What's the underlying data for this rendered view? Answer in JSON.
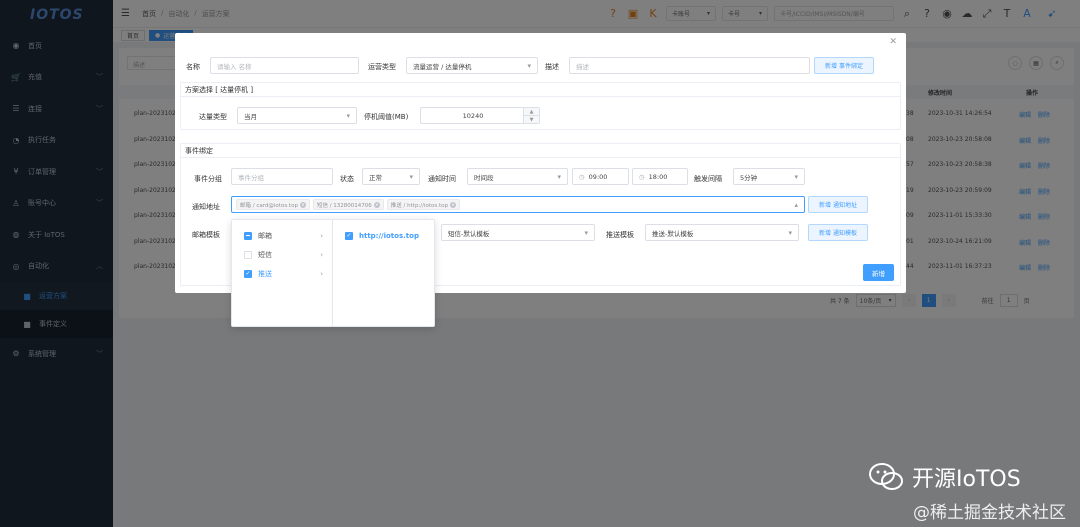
{
  "app": {
    "logo_text": "IOTOS"
  },
  "sidebar": {
    "items": [
      {
        "label": "首页",
        "icon": "dashboard-icon",
        "glyph": "◉"
      },
      {
        "label": "充值",
        "icon": "cart-icon",
        "glyph": "🛒",
        "has_children": true
      },
      {
        "label": "连接",
        "icon": "link-icon",
        "glyph": "☰",
        "has_children": true
      },
      {
        "label": "执行任务",
        "icon": "task-icon",
        "glyph": "◔"
      },
      {
        "label": "订单管理",
        "icon": "order-icon",
        "glyph": "¥",
        "has_children": true
      },
      {
        "label": "账号中心",
        "icon": "user-icon",
        "glyph": "♙",
        "has_children": true
      },
      {
        "label": "关于 IoTOS",
        "icon": "globe-icon",
        "glyph": "◍"
      },
      {
        "label": "自动化",
        "icon": "automation-icon",
        "glyph": "◎",
        "has_children": true,
        "open": true
      }
    ],
    "sub_items": [
      {
        "label": "运营方案",
        "active": true
      },
      {
        "label": "事件定义",
        "active": false
      }
    ],
    "last_item": {
      "label": "系统管理",
      "icon": "settings-icon",
      "glyph": "⚙",
      "has_children": true
    }
  },
  "topbar": {
    "breadcrumb": [
      "首页",
      "自动化",
      "运营方案"
    ],
    "select1": "卡账号",
    "select2": "卡号",
    "search_placeholder": "卡号/ICCID/IMSI/MSISDN/编号",
    "icons": [
      "help-circle-icon",
      "print-icon",
      "brand-k-icon",
      "question-icon",
      "user-circle-icon",
      "cloud-download-icon",
      "fullscreen-icon",
      "font-size-icon",
      "translate-icon",
      "bird-logo-icon"
    ]
  },
  "tags": [
    {
      "label": "首页",
      "active": false
    },
    {
      "label": "运营方案",
      "active": true
    }
  ],
  "background_table": {
    "search_placeholder": "描述",
    "headers": {
      "modified": "修改时间",
      "ops": "操作"
    },
    "rows": [
      {
        "id": "plan-2023102",
        "num": "38",
        "time": "2023-10-31 14:26:54"
      },
      {
        "id": "plan-2023102",
        "num": "08",
        "time": "2023-10-23 20:58:08"
      },
      {
        "id": "plan-2023102",
        "num": "57",
        "time": "2023-10-23 20:58:38"
      },
      {
        "id": "plan-2023102",
        "num": "19",
        "time": "2023-10-23 20:59:09"
      },
      {
        "id": "plan-2023102",
        "num": "09",
        "time": "2023-11-01 15:33:30"
      },
      {
        "id": "plan-2023102",
        "num": "01",
        "time": "2023-10-24 16:21:09"
      },
      {
        "id": "plan-2023102",
        "num": "44",
        "time": "2023-11-01 16:37:23"
      }
    ],
    "edit": "编辑",
    "delete": "删除"
  },
  "pagination": {
    "total": "共 7 条",
    "page_size": "10条/页",
    "current": "1",
    "goto_label": "前往",
    "goto_value": "1",
    "page_unit": "页"
  },
  "dialog": {
    "name_label": "名称",
    "name_placeholder": "请输入 名称",
    "type_label": "运营类型",
    "type_value": "流量运营 / 达量停机",
    "desc_label": "描述",
    "desc_placeholder": "描述",
    "add_event_btn": "新增 事件绑定",
    "scheme_section_title": "方案选择 [ 达量停机 ]",
    "quantity_type_label": "达量类型",
    "quantity_type_value": "当月",
    "threshold_label": "停机阈值(MB)",
    "threshold_value": "10240",
    "event_section_title": "事件绑定",
    "event_group_label": "事件分组",
    "event_group_placeholder": "事件分组",
    "status_label": "状态",
    "status_value": "正常",
    "notify_time_label": "通知时间",
    "notify_time_value": "时间段",
    "time_start": "09:00",
    "time_end": "18:00",
    "interval_label": "触发间隔",
    "interval_value": "5分钟",
    "notify_addr_label": "通知地址",
    "notify_chips": [
      "邮箱 / card@iotos.top",
      "短信 / 13280014706",
      "推送 / http://iotos.top"
    ],
    "add_addr_btn": "新增 通知地址",
    "mail_template_label": "邮箱模板",
    "sms_template_value": "短信-默认模板",
    "push_template_label": "推送模板",
    "push_template_value": "推送-默认模板",
    "add_template_btn": "新增 通知模板",
    "submit_btn": "新增"
  },
  "cascader": {
    "col1": [
      {
        "label": "邮箱",
        "state": "half",
        "active": false
      },
      {
        "label": "短信",
        "state": "none",
        "active": false
      },
      {
        "label": "推送",
        "state": "checked",
        "active": true
      }
    ],
    "col2": [
      {
        "label": "http://iotos.top",
        "state": "checked"
      }
    ]
  },
  "watermark": {
    "title": "开源IoTOS",
    "subtitle": "@稀土掘金技术社区"
  }
}
